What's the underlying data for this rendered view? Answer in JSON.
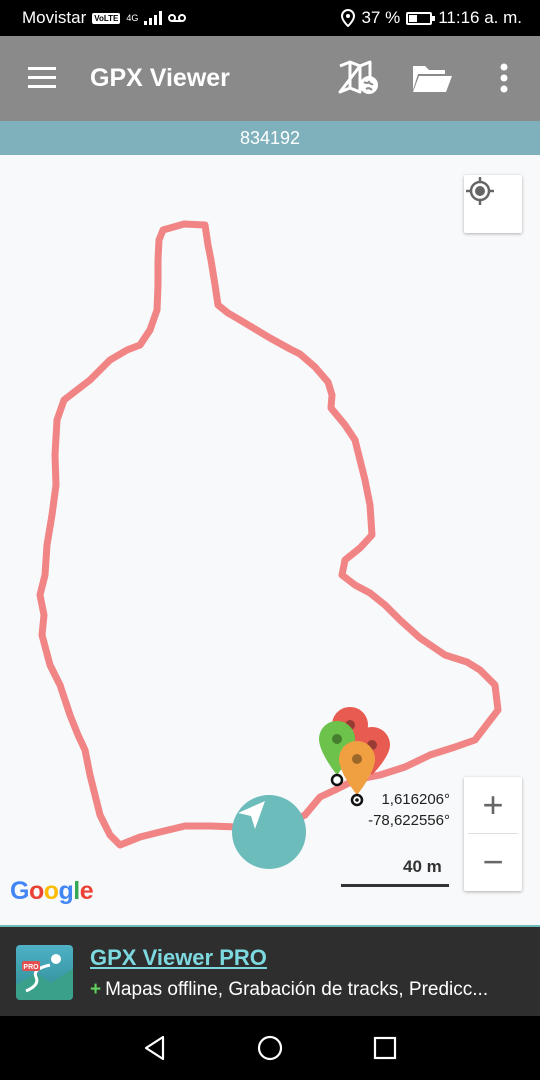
{
  "status_bar": {
    "carrier": "Movistar",
    "volte": "VoLTE",
    "network": "4G",
    "battery_text": "37 %",
    "battery_level": 0.37,
    "time": "11:16 a. m."
  },
  "toolbar": {
    "title": "GPX Viewer",
    "menu_icon": "hamburger-menu-icon",
    "map_icon": "map-globe-icon",
    "folder_icon": "folder-open-icon",
    "more_icon": "more-vert-icon"
  },
  "track": {
    "name": "834192"
  },
  "map": {
    "track_color": "#f07070",
    "coord_lat": "1,616206°",
    "coord_lon": "-78,622556°",
    "scale_label": "40 m",
    "zoom_in": "+",
    "zoom_out": "−",
    "google_logo": "Google",
    "markers": [
      {
        "name": "red-marker",
        "color": "#e85b50"
      },
      {
        "name": "green-marker",
        "color": "#6cc24a"
      },
      {
        "name": "orange-marker",
        "color": "#f0a040"
      }
    ]
  },
  "ad": {
    "title": "GPX Viewer PRO",
    "icon_label": "PRO",
    "plus": "+",
    "subtitle": "Mapas offline, Grabación de tracks, Predicc..."
  },
  "nav": {
    "back_icon": "back-triangle-icon",
    "home_icon": "home-circle-icon",
    "recents_icon": "recents-square-icon"
  }
}
